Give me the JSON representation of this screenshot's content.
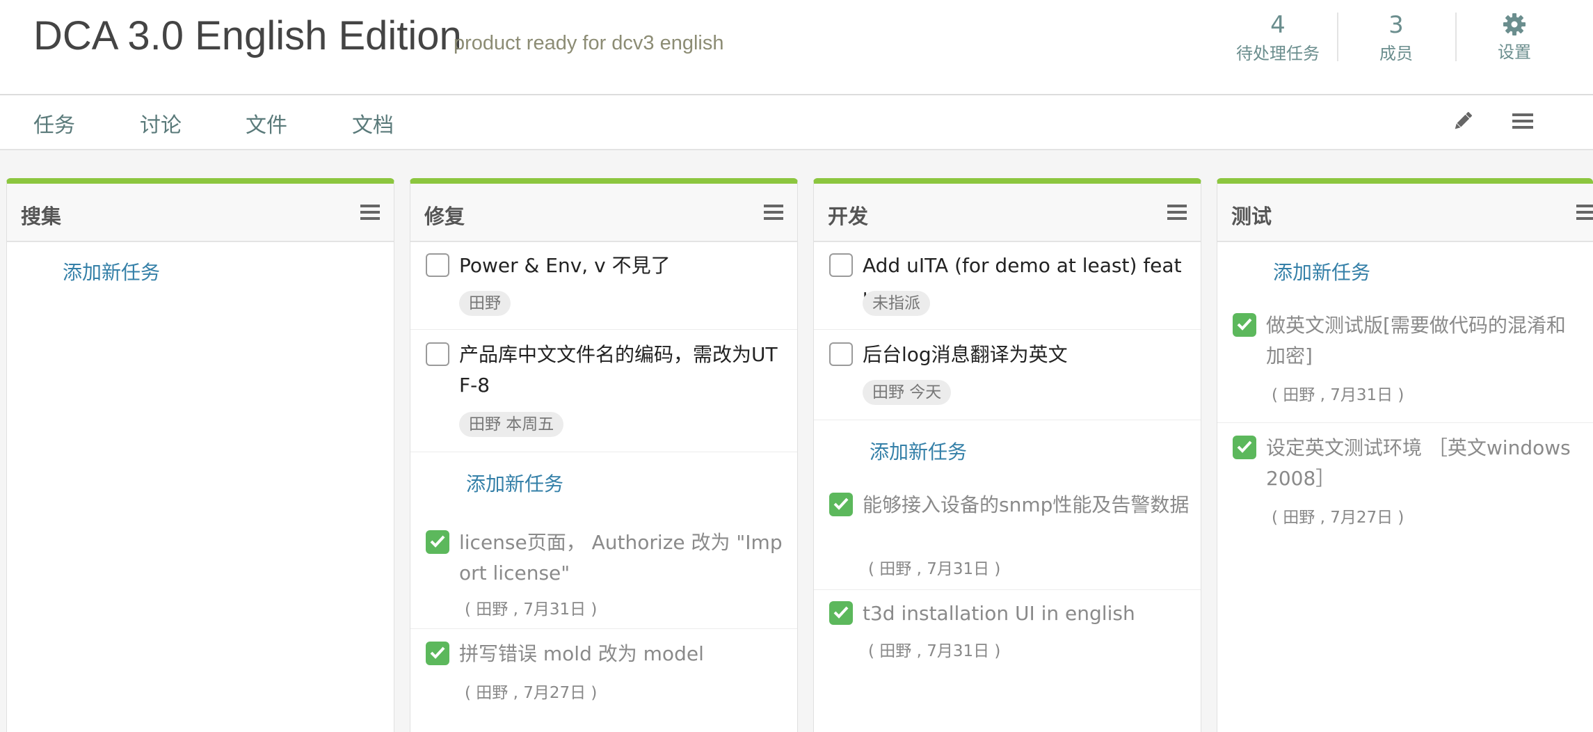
{
  "project": {
    "title": "DCA 3.0 English Edition",
    "description": "product ready for dcv3 english"
  },
  "stats": {
    "pending": {
      "value": "4",
      "label": "待处理任务"
    },
    "members": {
      "value": "3",
      "label": "成员"
    },
    "settings": {
      "label": "设置",
      "icon": "gear-icon"
    }
  },
  "nav": {
    "tabs": [
      "任务",
      "讨论",
      "文件",
      "文档"
    ],
    "icons": [
      "pencil-icon",
      "hamburger-menu-icon"
    ]
  },
  "colors": {
    "accent": "#8cc63f",
    "check": "#5cb85c",
    "link": "#3580a8"
  },
  "columns": [
    {
      "title": "搜集",
      "add_label": "添加新任务",
      "tasks": []
    },
    {
      "title": "修复",
      "add_label": "添加新任务",
      "tasks": [
        {
          "text": "Power & Env, v 不見了",
          "tag": "田野",
          "done": false
        },
        {
          "text": "产品库中文文件名的编码，需改为UTF-8",
          "tag": "田野 本周五",
          "done": false
        },
        {
          "text": "license页面， Authorize 改为 \"Import license\"",
          "meta": "( 田野 , 7月31日 )",
          "done": true
        },
        {
          "text": "拼写错误 mold 改为 model",
          "meta": "( 田野 , 7月27日 )",
          "done": true
        }
      ]
    },
    {
      "title": "开发",
      "add_label": "添加新任务",
      "tasks": [
        {
          "text": "Add uITA (for demo at least) feature",
          "tag": "未指派",
          "done": false
        },
        {
          "text": "后台log消息翻译为英文",
          "tag": "田野 今天",
          "done": false
        },
        {
          "text": "能够接入设备的snmp性能及告警数据",
          "meta": "( 田野 , 7月31日 )",
          "done": true
        },
        {
          "text": "t3d installation UI in english",
          "meta": "( 田野 , 7月31日 )",
          "done": true
        }
      ]
    },
    {
      "title": "测试",
      "add_label": "添加新任务",
      "tasks": [
        {
          "text": "做英文测试版[需要做代码的混淆和加密]",
          "meta": "( 田野 , 7月31日 )",
          "done": true
        },
        {
          "text": "设定英文测试环境 ［英文windows 2008］",
          "meta": "( 田野 , 7月27日 )",
          "done": true
        }
      ]
    }
  ]
}
